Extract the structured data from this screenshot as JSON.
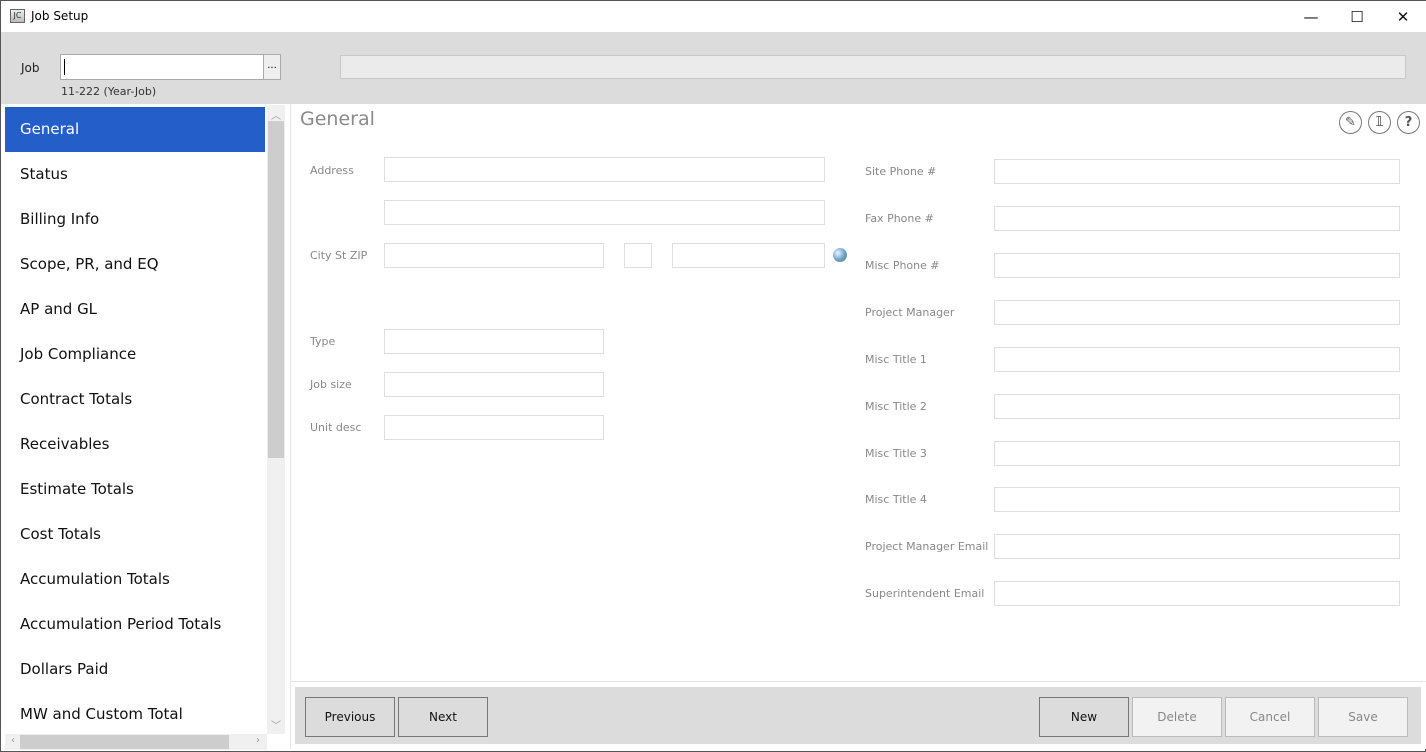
{
  "window": {
    "title": "Job Setup",
    "icon_text": "JC",
    "minimize": "—",
    "maximize": "☐",
    "close": "✕"
  },
  "header": {
    "job_label": "Job",
    "job_value": "",
    "browse_label": "...",
    "job_hint": "11-222 (Year-Job)"
  },
  "sidebar": {
    "items": [
      {
        "label": "General",
        "selected": true
      },
      {
        "label": "Status"
      },
      {
        "label": "Billing Info"
      },
      {
        "label": "Scope, PR, and EQ"
      },
      {
        "label": "AP and GL"
      },
      {
        "label": "Job Compliance"
      },
      {
        "label": "Contract Totals"
      },
      {
        "label": "Receivables"
      },
      {
        "label": "Estimate Totals"
      },
      {
        "label": "Cost Totals"
      },
      {
        "label": "Accumulation Totals"
      },
      {
        "label": "Accumulation Period Totals"
      },
      {
        "label": "Dollars Paid"
      },
      {
        "label": "MW and Custom Total"
      }
    ]
  },
  "main": {
    "title": "General",
    "icons": [
      "pencil-icon",
      "attachment-icon",
      "help-icon"
    ],
    "left_labels": {
      "address": "Address",
      "city": "City St ZIP",
      "type": "Type",
      "job_size": "Job size",
      "unit_desc": "Unit desc"
    },
    "right_fields": [
      {
        "label": "Site Phone #",
        "value": ""
      },
      {
        "label": "Fax Phone #",
        "value": ""
      },
      {
        "label": "Misc Phone #",
        "value": ""
      },
      {
        "label": "Project Manager",
        "value": ""
      },
      {
        "label": "Misc Title 1",
        "value": ""
      },
      {
        "label": "Misc Title 2",
        "value": ""
      },
      {
        "label": "Misc Title 3",
        "value": ""
      },
      {
        "label": "Misc Title 4",
        "value": ""
      },
      {
        "label": "Project Manager Email",
        "value": ""
      },
      {
        "label": "Superintendent Email",
        "value": ""
      }
    ]
  },
  "footer": {
    "previous": "Previous",
    "next": "Next",
    "new": "New",
    "delete": "Delete",
    "cancel": "Cancel",
    "save": "Save"
  },
  "colors": {
    "selected": "#245ec8",
    "header_bg": "#dcdcdc"
  }
}
